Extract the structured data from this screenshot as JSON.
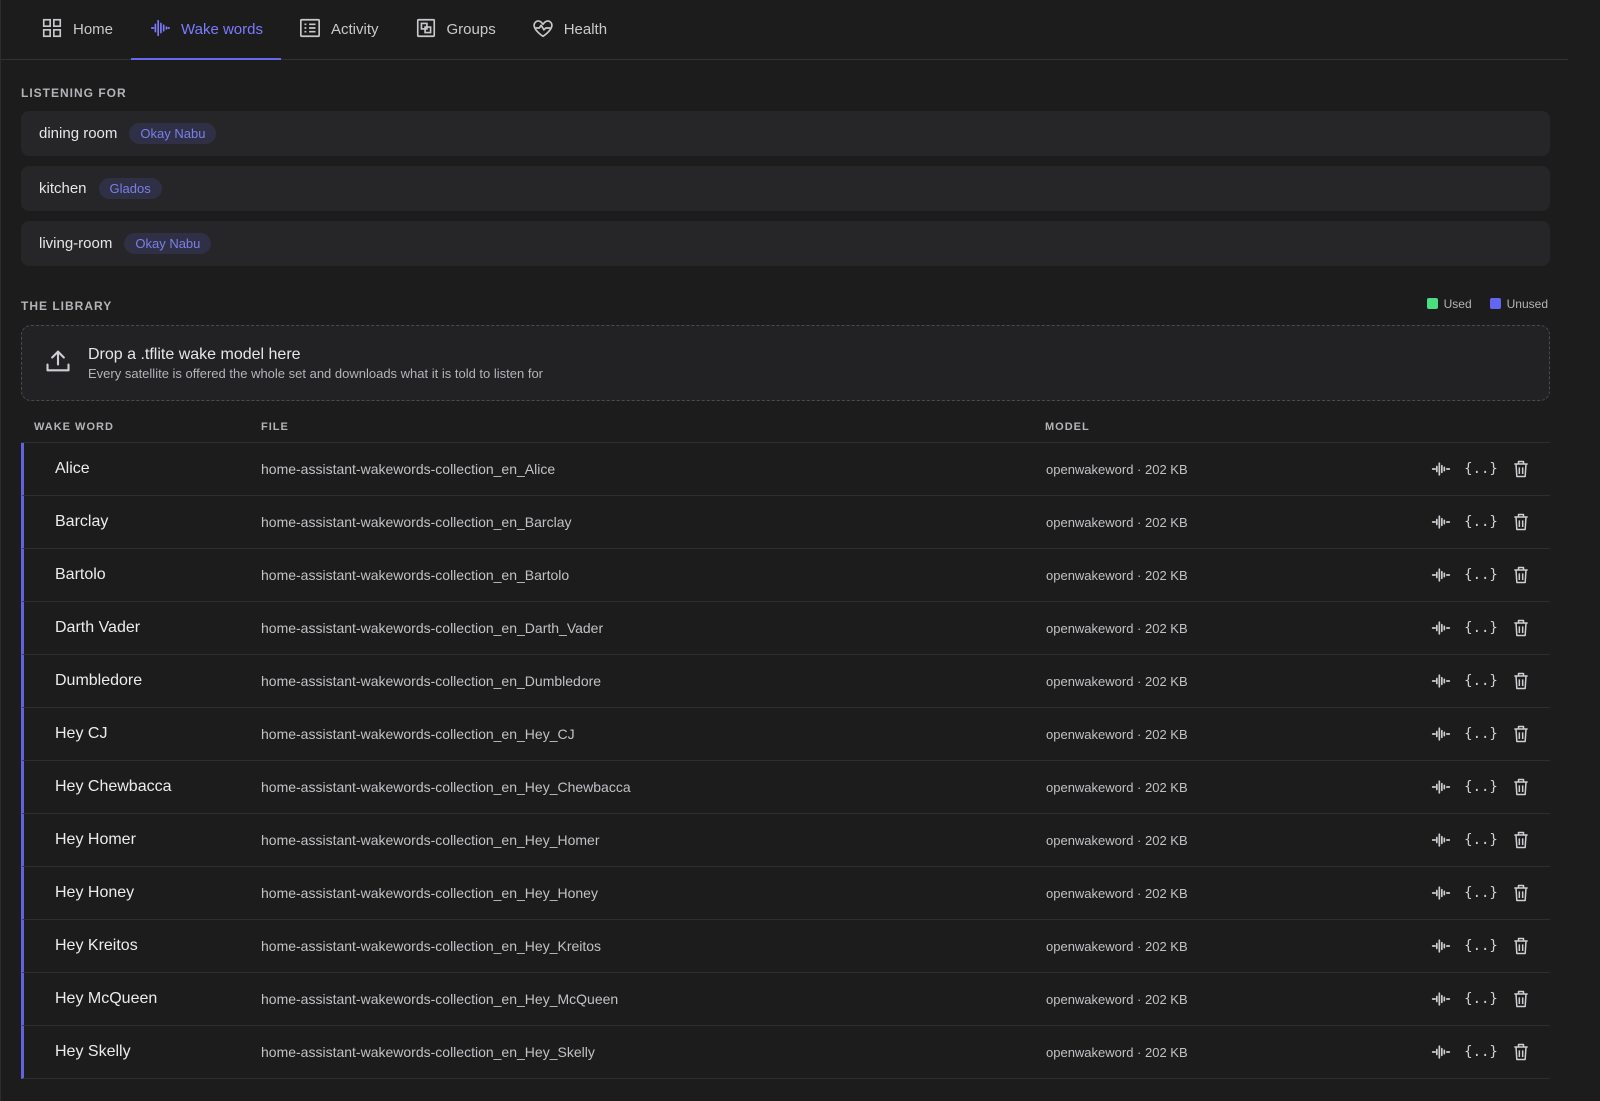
{
  "nav": {
    "tabs": [
      {
        "label": "Home",
        "icon": "grid-icon"
      },
      {
        "label": "Wake words",
        "icon": "waveform-icon",
        "active": true
      },
      {
        "label": "Activity",
        "icon": "list-icon"
      },
      {
        "label": "Groups",
        "icon": "groups-icon"
      },
      {
        "label": "Health",
        "icon": "heartbeat-icon"
      }
    ]
  },
  "listening": {
    "title": "LISTENING FOR",
    "satellites": [
      {
        "name": "dining room",
        "wake_word": "Okay Nabu"
      },
      {
        "name": "kitchen",
        "wake_word": "Glados"
      },
      {
        "name": "living-room",
        "wake_word": "Okay Nabu"
      }
    ]
  },
  "library": {
    "title": "THE LIBRARY",
    "legend": {
      "used": "Used",
      "unused": "Unused",
      "used_color": "#4ade80",
      "unused_color": "#6366f1"
    },
    "drop": {
      "title": "Drop a .tflite wake model here",
      "subtitle": "Every satellite is offered the whole set and downloads what it is told to listen for"
    },
    "columns": {
      "wake_word": "WAKE WORD",
      "file": "FILE",
      "model": "MODEL"
    },
    "rows": [
      {
        "name": "Alice",
        "file": "home-assistant-wakewords-collection_en_Alice",
        "model": "openwakeword · 202 KB"
      },
      {
        "name": "Barclay",
        "file": "home-assistant-wakewords-collection_en_Barclay",
        "model": "openwakeword · 202 KB"
      },
      {
        "name": "Bartolo",
        "file": "home-assistant-wakewords-collection_en_Bartolo",
        "model": "openwakeword · 202 KB"
      },
      {
        "name": "Darth Vader",
        "file": "home-assistant-wakewords-collection_en_Darth_Vader",
        "model": "openwakeword · 202 KB"
      },
      {
        "name": "Dumbledore",
        "file": "home-assistant-wakewords-collection_en_Dumbledore",
        "model": "openwakeword · 202 KB"
      },
      {
        "name": "Hey CJ",
        "file": "home-assistant-wakewords-collection_en_Hey_CJ",
        "model": "openwakeword · 202 KB"
      },
      {
        "name": "Hey Chewbacca",
        "file": "home-assistant-wakewords-collection_en_Hey_Chewbacca",
        "model": "openwakeword · 202 KB"
      },
      {
        "name": "Hey Homer",
        "file": "home-assistant-wakewords-collection_en_Hey_Homer",
        "model": "openwakeword · 202 KB"
      },
      {
        "name": "Hey Honey",
        "file": "home-assistant-wakewords-collection_en_Hey_Honey",
        "model": "openwakeword · 202 KB"
      },
      {
        "name": "Hey Kreitos",
        "file": "home-assistant-wakewords-collection_en_Hey_Kreitos",
        "model": "openwakeword · 202 KB"
      },
      {
        "name": "Hey McQueen",
        "file": "home-assistant-wakewords-collection_en_Hey_McQueen",
        "model": "openwakeword · 202 KB"
      },
      {
        "name": "Hey Skelly",
        "file": "home-assistant-wakewords-collection_en_Hey_Skelly",
        "model": "openwakeword · 202 KB"
      }
    ],
    "row_actions": {
      "test_icon": "waveform-icon",
      "json_label": "{..}",
      "delete_icon": "trash-icon"
    }
  }
}
